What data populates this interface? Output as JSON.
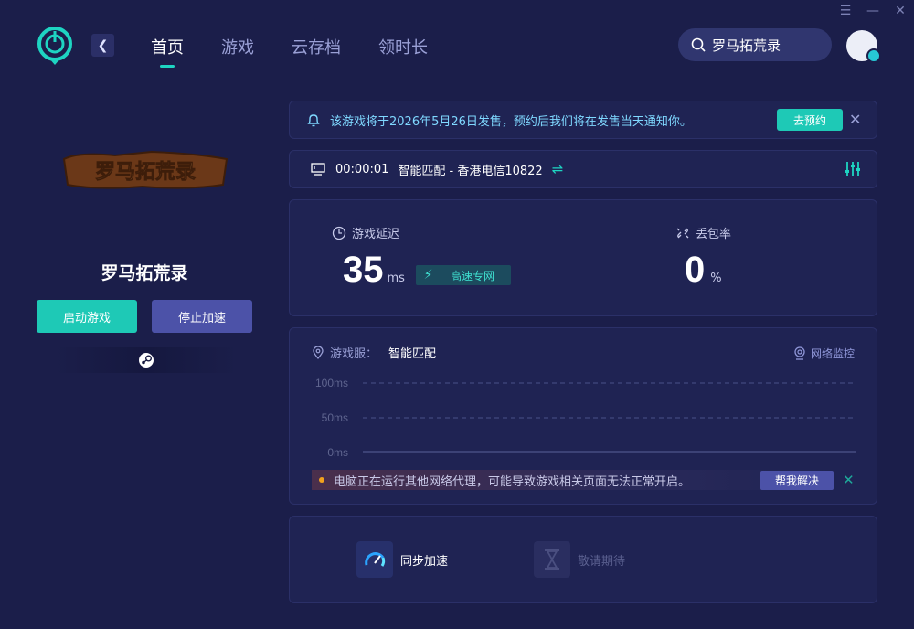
{
  "window_controls": [
    "☰",
    "—",
    "✕"
  ],
  "nav": {
    "back_icon": "chevron-left-icon",
    "items": [
      {
        "label": "首页",
        "active": true
      },
      {
        "label": "游戏",
        "active": false
      },
      {
        "label": "云存档",
        "active": false
      },
      {
        "label": "领时长",
        "active": false
      }
    ]
  },
  "search": {
    "value": "罗马拓荒录",
    "icon": "search-icon"
  },
  "left": {
    "logo_text": "罗马拓荒录",
    "title": "罗马拓荒录",
    "start_label": "启动游戏",
    "stop_label": "停止加速",
    "platform_icon": "steam-icon"
  },
  "notice": {
    "text": "该游戏将于2026年5月26日发售，预约后我们将在发售当天通知你。",
    "button": "去预约"
  },
  "route": {
    "time": "00:00:01",
    "node": "智能匹配 - 香港电信10822"
  },
  "stats": {
    "latency_label": "游戏延迟",
    "latency_value": "35",
    "latency_unit": "ms",
    "line_tag": "高速专网",
    "loss_label": "丢包率",
    "loss_value": "0",
    "loss_unit": "%"
  },
  "graph": {
    "server_label": "游戏服：",
    "server_value": "智能匹配",
    "monitor_label": "网络监控",
    "y_ticks": [
      "100ms",
      "50ms",
      "0ms"
    ],
    "warning": "电脑正在运行其他网络代理，可能导致游戏相关页面无法正常开启。",
    "help_button": "帮我解决"
  },
  "features": [
    {
      "label": "同步加速",
      "icon": "speedometer-icon",
      "enabled": true
    },
    {
      "label": "敬请期待",
      "icon": "hourglass-icon",
      "enabled": false
    }
  ],
  "colors": {
    "accent": "#1ec9b6",
    "secondary_button": "#4c52a8",
    "background": "#1b1e4a",
    "card": "#1f2353"
  }
}
